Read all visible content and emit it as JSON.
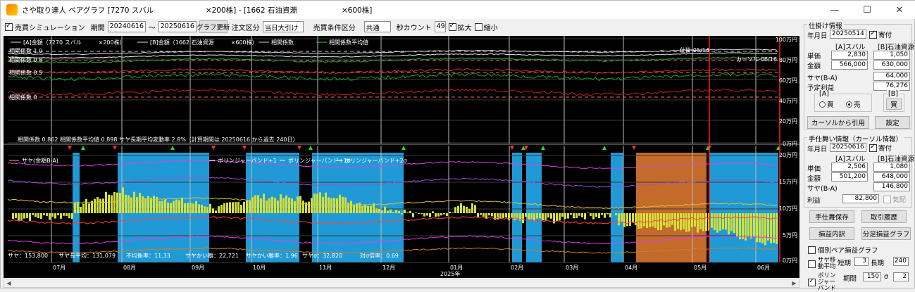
{
  "window": {
    "title": "さや取り達人 ペアグラフ [7270 スバル　　　　　　　×200株] - [1662 石油資源　　　　　　×600株]",
    "buttons": [
      "—",
      "☐",
      "✕"
    ]
  },
  "toolbar": {
    "sim_label": "売買シミュレーション",
    "sim_checked": true,
    "period_label": "期間",
    "period_from": "20240616",
    "tilde": "〜",
    "period_to": "20250616",
    "update_button": "グラフ更新",
    "order_type_label": "注文区分",
    "order_type_value": "当日大引け",
    "trade_cond_label": "売買条件区分",
    "trade_cond_value": "共通",
    "seconds_label": "秒カウント",
    "seconds_value": "49",
    "zoom_in_label": "拡大",
    "zoom_in_checked": true,
    "zoom_out_label": "縮小",
    "zoom_out_checked": false
  },
  "chart": {
    "top_legend": [
      "[A]金額（7270 スバル　　　×200株）",
      "[B]金額（1662 石油資源　　　×600株）",
      "相関係数",
      "相関係数平均値"
    ],
    "corr_labels": [
      "相関係数 1.0",
      "相関係数 0.8",
      "相関係数 0.5",
      "相関係数 0"
    ],
    "marker_entry": "仕掛-05/14",
    "marker_cursor": "カーソル-06/16",
    "status_line": "相関係数 0.862  相関係数平均値 0.898  サヤ長期平均変動率 2.8%（計算期間は 20250616 から過去 240日）",
    "bottom_legend": "サヤ(金額B-A)",
    "band_labels": [
      "ボリンジャーバンド+1",
      "ボリンジャーバンド+1σ",
      "ボリンジャーバンド+2σ"
    ],
    "stats": [
      "サヤ：153,800",
      "サヤ長平均：131,079",
      "不均衡率：11.33",
      "サヤかい離：22,721",
      "サヤかい離率：1.96",
      "サヤσ：32,820",
      "対σ倍率：0.69"
    ],
    "x_labels": [
      "07月",
      "08月",
      "09月",
      "10月",
      "11月",
      "12月",
      "01月",
      "02月",
      "03月",
      "04月",
      "05月",
      "06月"
    ],
    "year_label": "2025年",
    "y_top": [
      "100万円",
      "80万円",
      "60万円",
      "40万円",
      "20万円",
      "0万円"
    ],
    "y_bottom": [
      "20万円",
      "15万円",
      "10万円",
      "5万円",
      "0万円"
    ]
  },
  "chart_data": {
    "type": "bar",
    "title": "",
    "top_panel": {
      "y_range": [
        0,
        1000000
      ],
      "series_names": [
        "[A]金額",
        "[B]金額",
        "相関係数",
        "相関係数平均値"
      ]
    },
    "bottom_panel": {
      "series_name": "サヤ(金額B-A)",
      "y_range": [
        0,
        200000
      ],
      "current_spread": 153800,
      "long_average": 131079
    },
    "x_categories": [
      "07月",
      "08月",
      "09月",
      "10月",
      "11月",
      "12月",
      "01月",
      "02月",
      "03月",
      "04月",
      "05月",
      "06月"
    ]
  },
  "panel": {
    "entry_group_title": "仕掛け情報",
    "date_label": "年月日",
    "entry_date": "20250514",
    "yorituki_label": "寄付",
    "yorituki_checked": true,
    "col_a": "[A]スバル",
    "col_b": "[B]石油資源",
    "unit_price_label": "単価",
    "amount_label": "金額",
    "entry_a_price": "2,830",
    "entry_b_price": "1,050",
    "entry_a_amount": "566,000",
    "entry_b_amount": "630,000",
    "spread_label": "サヤ(B-A)",
    "entry_spread": "64,000",
    "expected_profit_label": "予定利益",
    "expected_profit": "76,276",
    "a_side_label": "[A]",
    "b_side_label": "[B]",
    "buy_label": "買",
    "sell_label": "売",
    "b_buy_label": "買",
    "cursor_quote_button": "カーソルから引用",
    "settings_button": "設定",
    "exit_group_title": "手仕舞い情報（カーソル情報）",
    "exit_date": "20250616",
    "exit_yorituki_checked": true,
    "exit_a_price": "2,506",
    "exit_b_price": "1,080",
    "exit_a_amount": "501,200",
    "exit_b_amount": "648,000",
    "exit_spread": "146,800",
    "profit_label": "利益",
    "profit": "82,800",
    "auto_label": "気配",
    "save_exit_button": "手仕舞保存",
    "history_button": "取引履歴",
    "pnl_detail_button": "損益内訳",
    "dist_graph_button": "分足損益グラフ",
    "pair_pnl_label": "個別ペア損益グラフ",
    "pair_pnl_checked": false,
    "ma_label": "サヤ移動平均",
    "short_label": "短期",
    "short_value": "3",
    "long_label": "長期",
    "long_value": "240",
    "bb_label": "ボリンジャーバンド",
    "bb_checked": true,
    "bb_period_label": "期間",
    "bb_period": "150",
    "sigma_label": "σ",
    "sigma_value": "2"
  }
}
